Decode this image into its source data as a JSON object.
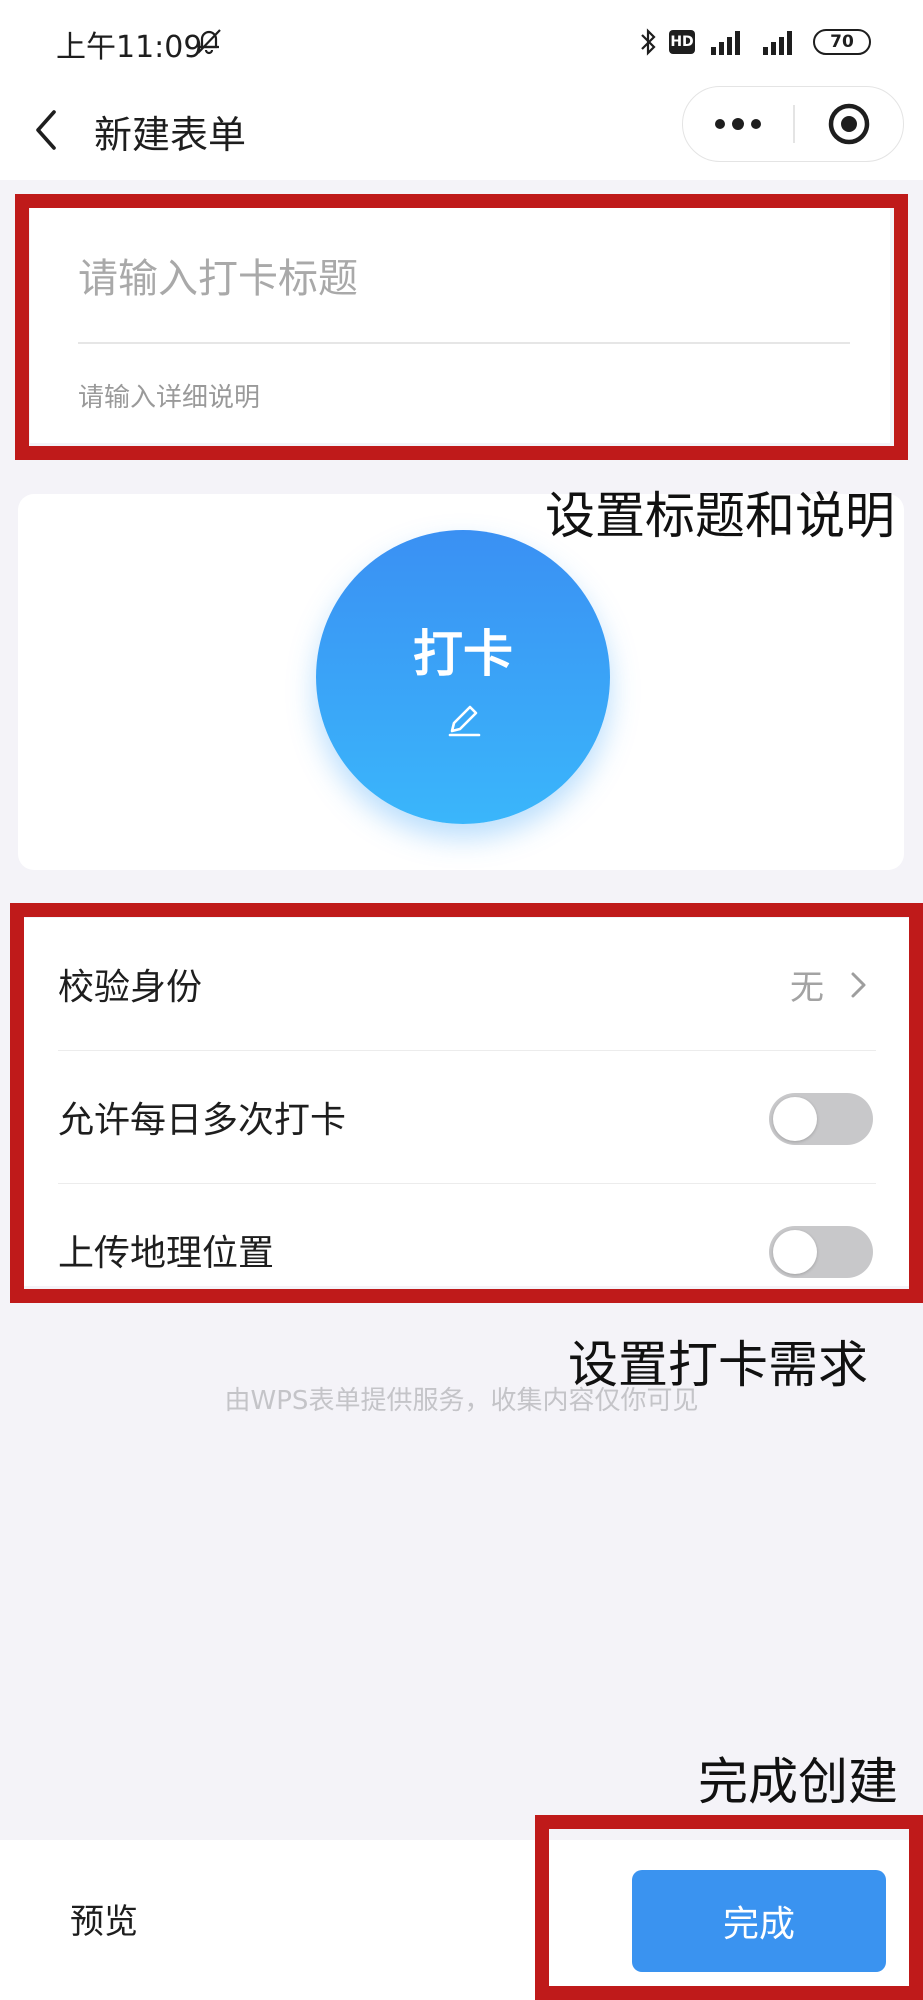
{
  "status_bar": {
    "time": "上午11:09",
    "hd": "HD",
    "battery": "70"
  },
  "nav": {
    "title": "新建表单"
  },
  "form": {
    "title_placeholder": "请输入打卡标题",
    "description_placeholder": "请输入详细说明"
  },
  "cover": {
    "label": "打卡"
  },
  "settings": {
    "items": [
      {
        "label": "校验身份",
        "value": "无"
      },
      {
        "label": "允许每日多次打卡",
        "enabled": false
      },
      {
        "label": "上传地理位置",
        "enabled": false
      }
    ]
  },
  "footer_note": "由WPS表单提供服务，收集内容仅你可见",
  "bottom_bar": {
    "preview_label": "预览",
    "done_label": "完成"
  },
  "annotations": {
    "title_caption": "设置标题和说明",
    "settings_caption": "设置打卡需求",
    "done_caption": "完成创建",
    "highlight_color": "#bf1a1a"
  },
  "colors": {
    "accent": "#3a93f0",
    "page_bg": "#f4f3f8"
  }
}
